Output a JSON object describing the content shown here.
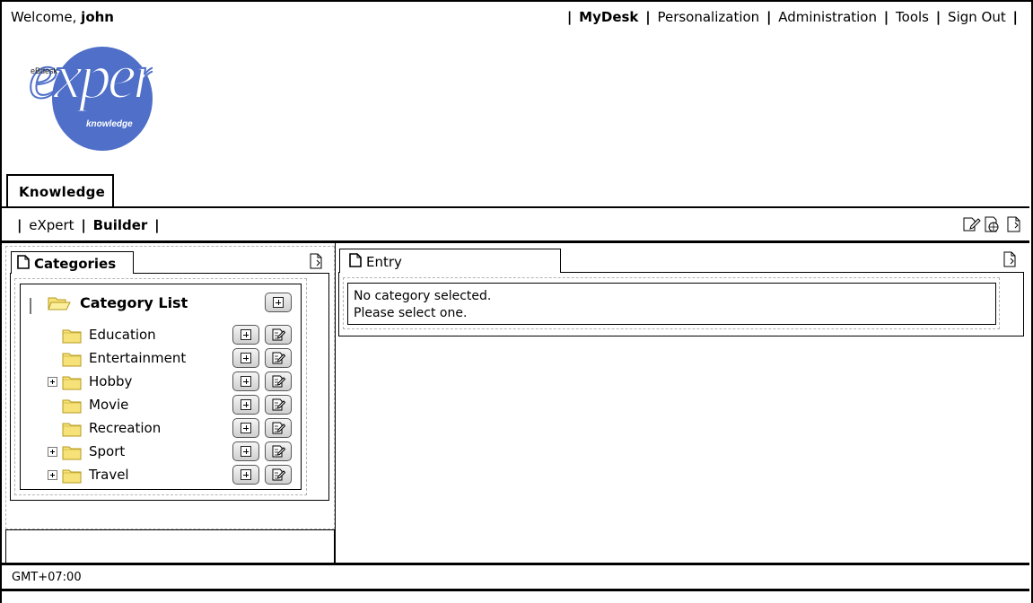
{
  "header": {
    "welcome_prefix": "Welcome,",
    "username": "john",
    "nav": [
      {
        "label": "MyDesk",
        "active": true
      },
      {
        "label": "Personalization",
        "active": false
      },
      {
        "label": "Administration",
        "active": false
      },
      {
        "label": "Tools",
        "active": false
      },
      {
        "label": "Sign Out",
        "active": false
      }
    ]
  },
  "logo": {
    "brand_small": "eBdesk",
    "brand_main": "expert",
    "brand_sub": "knowledge",
    "color": "#4f6fc8"
  },
  "tabs": [
    {
      "label": "Knowledge"
    }
  ],
  "subnav": {
    "items": [
      "eXpert",
      "Builder"
    ],
    "icons": [
      "edit-doc-icon",
      "web-doc-icon",
      "new-doc-icon"
    ]
  },
  "categories_panel": {
    "title": "Categories",
    "root_label": "Category List",
    "items": [
      {
        "label": "Education",
        "expandable": false
      },
      {
        "label": "Entertainment",
        "expandable": false
      },
      {
        "label": "Hobby",
        "expandable": true
      },
      {
        "label": "Movie",
        "expandable": false
      },
      {
        "label": "Recreation",
        "expandable": false
      },
      {
        "label": "Sport",
        "expandable": true
      },
      {
        "label": "Travel",
        "expandable": true
      }
    ]
  },
  "entry_panel": {
    "title": "Entry",
    "message_line1": "No category selected.",
    "message_line2": "Please select one."
  },
  "footer": {
    "timezone": "GMT+07:00"
  },
  "colors": {
    "folder": "#f7e27a",
    "folder_border": "#b59a1c",
    "dashed_border": "#b5b5b5"
  }
}
